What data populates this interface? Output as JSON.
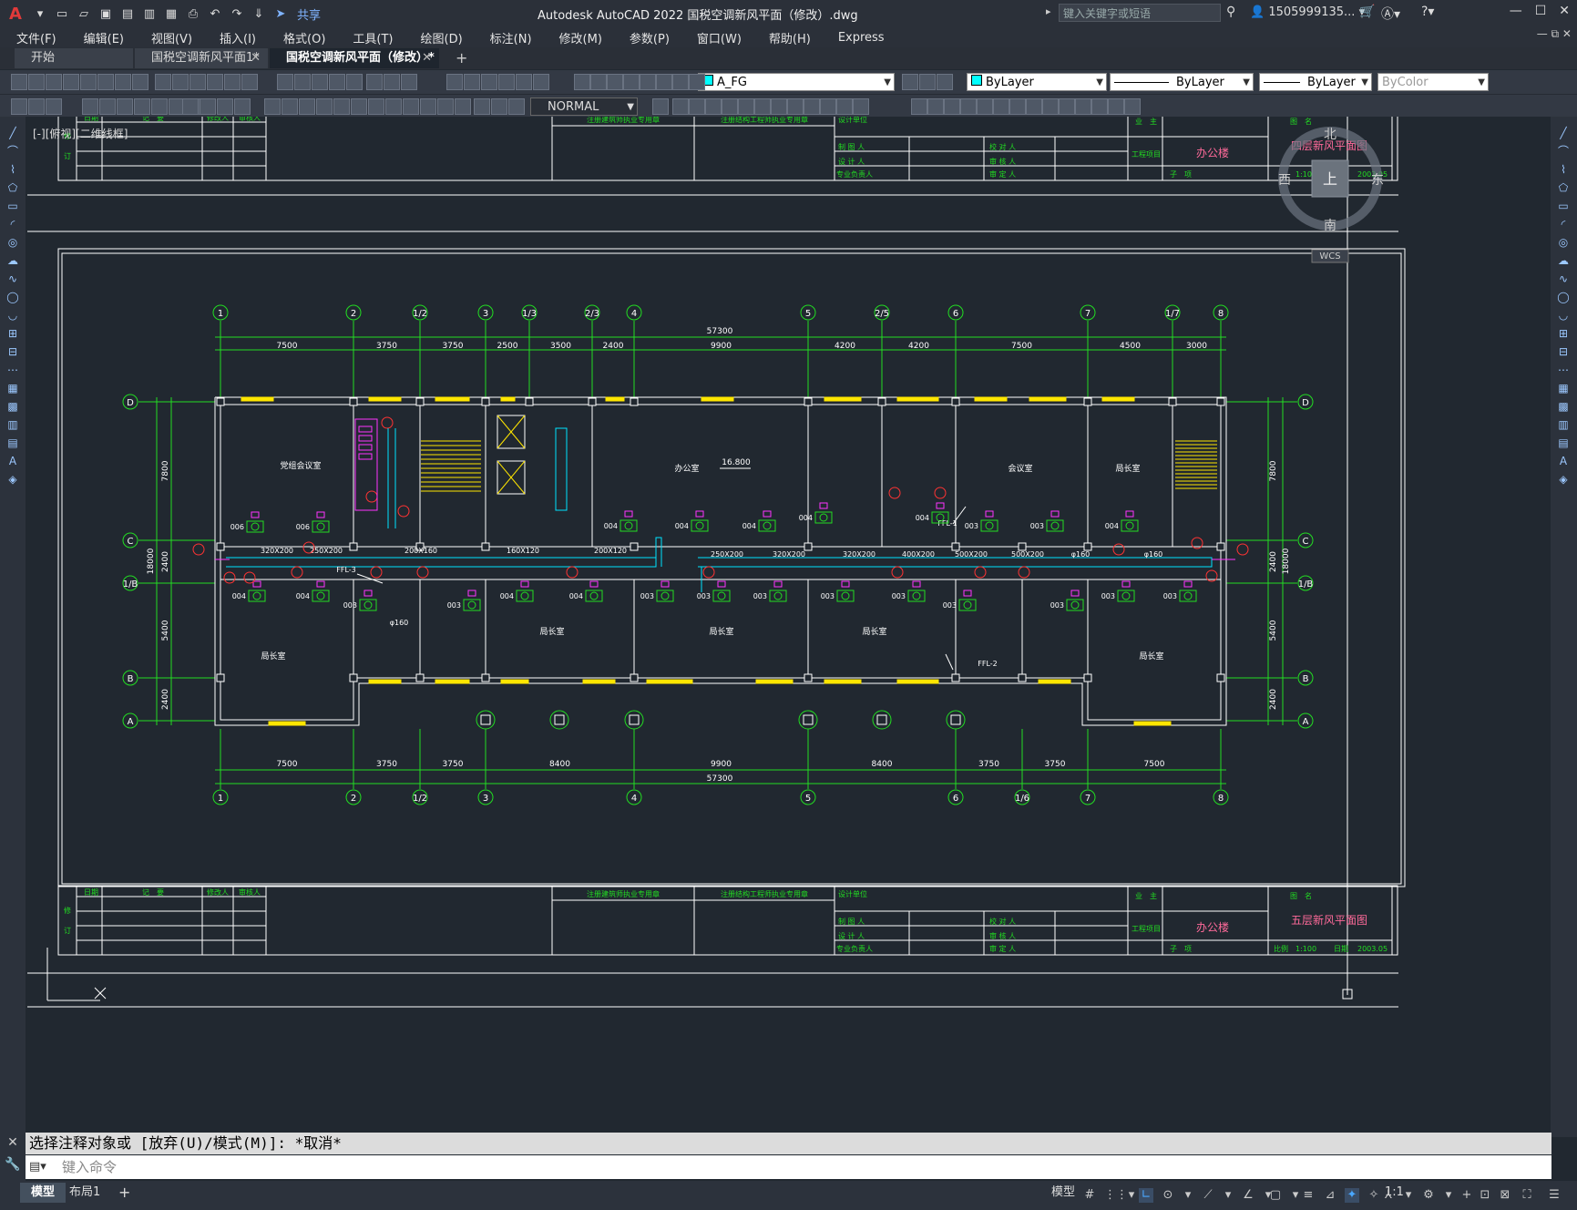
{
  "titlebar": {
    "title": "Autodesk AutoCAD 2022    国税空调新风平面（修改）.dwg",
    "share": "共享",
    "search_placeholder": "键入关键字或短语",
    "user": "1505999135...",
    "logo": "A"
  },
  "menu": [
    "文件(F)",
    "编辑(E)",
    "视图(V)",
    "插入(I)",
    "格式(O)",
    "工具(T)",
    "绘图(D)",
    "标注(N)",
    "修改(M)",
    "参数(P)",
    "窗口(W)",
    "帮助(H)",
    "Express"
  ],
  "tabs": [
    {
      "label": "开始"
    },
    {
      "label": "国税空调新风平面1*"
    },
    {
      "label": "国税空调新风平面（修改）*"
    }
  ],
  "toolbar": {
    "layer": "A_FG",
    "color": "ByLayer",
    "linetype": "ByLayer",
    "lineweight": "ByLayer",
    "plotstyle": "ByColor",
    "textstyle": "NORMAL"
  },
  "viewport_label": "[-][俯视][二维线框]",
  "viewcube": {
    "n": "北",
    "s": "南",
    "w": "西",
    "e": "东",
    "top": "上",
    "wcs": "WCS"
  },
  "drawing": {
    "top_block": {
      "project": "办公楼",
      "sheet_title": "四层新风平面图",
      "scale": "1:100",
      "date": "2003.05"
    },
    "bottom_block": {
      "project": "办公楼",
      "sheet_title": "五层新风平面图",
      "scale_label": "比例",
      "scale": "1:100",
      "date_label": "日期",
      "date": "2003.05"
    },
    "tb_labels": {
      "date": "日期",
      "record": "记　要",
      "modifier": "修改人",
      "reviewer": "审核人",
      "arch_seal": "注册建筑师执业专用章",
      "struct_seal": "注册结构工程师执业专用章",
      "design_unit": "设计单位",
      "owner": "业　主",
      "project": "工程项目",
      "drawing_name": "图　名",
      "drafter": "制 图 人",
      "designer": "设 计 人",
      "chief": "专业负责人",
      "checker": "校 对 人",
      "auditor": "审 核 人",
      "approver": "审 定 人",
      "sub_item": "子　项",
      "revise": "修",
      "revise2": "订"
    },
    "total_dim": "57300",
    "top_dims": [
      "7500",
      "3750",
      "3750",
      "2500",
      "3500",
      "2400",
      "9900",
      "4200",
      "4200",
      "7500",
      "4500",
      "3000"
    ],
    "bottom_dims": [
      "7500",
      "3750",
      "3750",
      "8400",
      "9900",
      "8400",
      "3750",
      "3750",
      "7500"
    ],
    "top_axes": [
      "1",
      "2",
      "1/2",
      "3",
      "1/3",
      "2/3",
      "4",
      "5",
      "2/5",
      "6",
      "7",
      "1/7",
      "8"
    ],
    "bottom_axes": [
      "1",
      "2",
      "1/2",
      "3",
      "4",
      "5",
      "6",
      "1/6",
      "7",
      "8"
    ],
    "row_axes": [
      "D",
      "C",
      "1/B",
      "B",
      "A"
    ],
    "left_dims": [
      "7800",
      "2400",
      "5400",
      "2400"
    ],
    "left_total": "18000",
    "rooms": [
      "党组会议室",
      "局长室",
      "局长室",
      "办公室",
      "局长室",
      "局长室",
      "会议室",
      "局长室",
      "局长室"
    ],
    "elevation": "16.800",
    "ducts": [
      "320X200",
      "250X200",
      "200X160",
      "160X120",
      "200X120",
      "250X200",
      "320X200",
      "320X200",
      "400X200",
      "500X200",
      "500X200",
      "φ160",
      "φ160",
      "φ160",
      "FFL-1",
      "FFL-2",
      "FFL-3"
    ],
    "units": [
      "006",
      "006",
      "004",
      "004",
      "004",
      "004",
      "004",
      "003",
      "003",
      "004",
      "004",
      "004",
      "003",
      "003",
      "003",
      "003",
      "003",
      "003",
      "003",
      "003",
      "003",
      "003",
      "003",
      "004",
      "004"
    ]
  },
  "command": {
    "history": "选择注释对象或 [放弃(U)/模式(M)]: *取消*",
    "placeholder": "键入命令"
  },
  "status": {
    "layout_tabs": [
      "模型",
      "布局1"
    ],
    "model": "模型",
    "scale": "1:1"
  }
}
